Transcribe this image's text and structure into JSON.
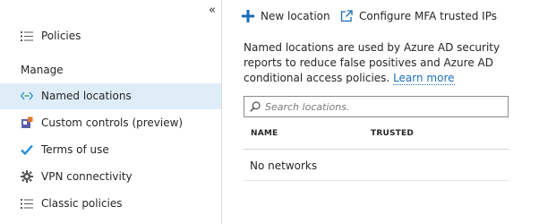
{
  "sidebar": {
    "collapse_glyph": "«",
    "top_item": {
      "label": "Policies",
      "icon": "list-icon"
    },
    "section_label": "Manage",
    "items": [
      {
        "label": "Named locations",
        "icon": "named-locations-icon",
        "active": true
      },
      {
        "label": "Custom controls (preview)",
        "icon": "custom-controls-icon",
        "active": false
      },
      {
        "label": "Terms of use",
        "icon": "checkmark-icon",
        "active": false
      },
      {
        "label": "VPN connectivity",
        "icon": "gear-icon",
        "active": false
      },
      {
        "label": "Classic policies",
        "icon": "list-icon",
        "active": false
      }
    ]
  },
  "toolbar": {
    "new_location_label": "New location",
    "configure_mfa_label": "Configure MFA trusted IPs"
  },
  "main": {
    "description": "Named locations are used by Azure AD security reports to reduce false positives and Azure AD conditional access policies.",
    "learn_more_label": "Learn more",
    "search_placeholder": "Search locations.",
    "columns": [
      "NAME",
      "TRUSTED"
    ],
    "empty_message": "No networks"
  },
  "colors": {
    "accent": "#1a6fb8",
    "active_bg": "#deedf8"
  }
}
